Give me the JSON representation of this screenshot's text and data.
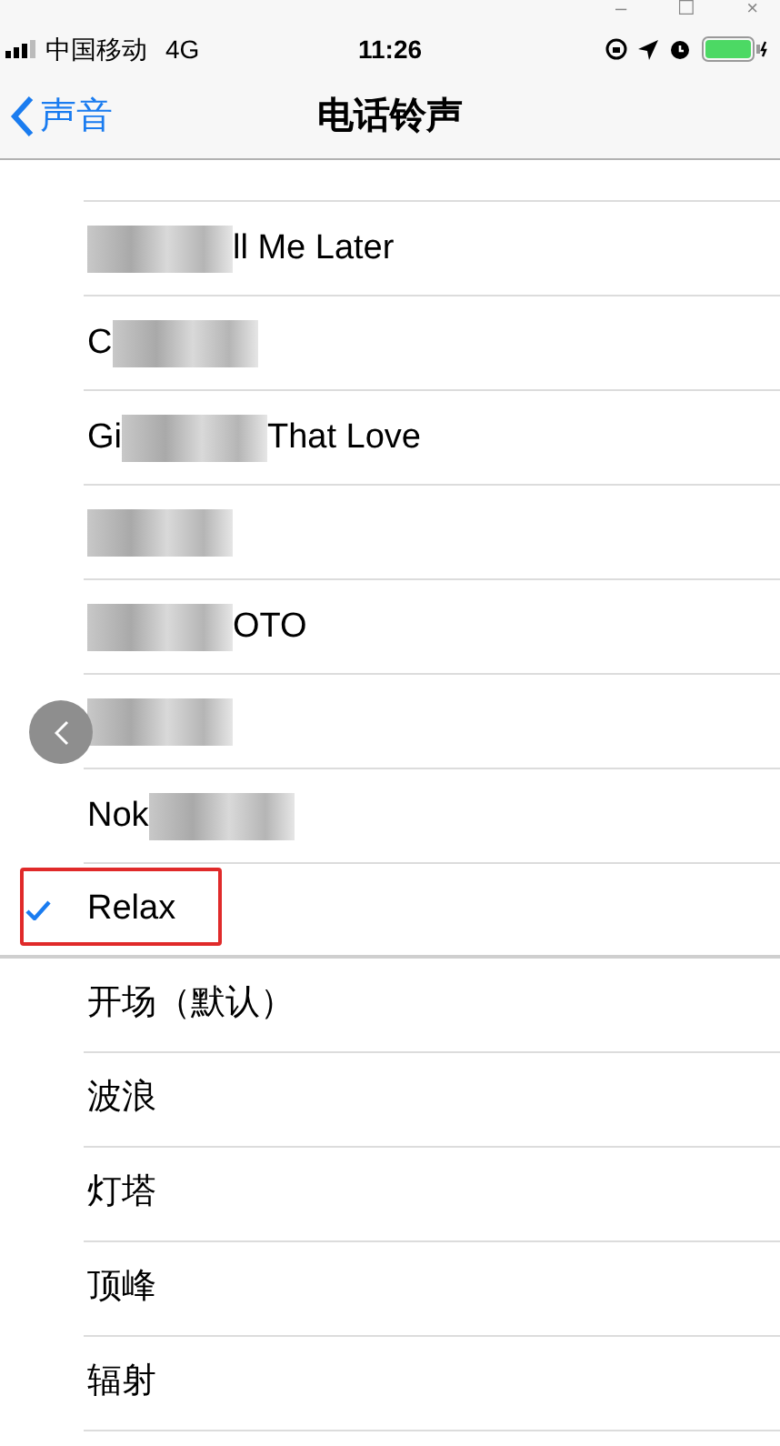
{
  "window_controls": [
    "–",
    "☐",
    "×"
  ],
  "status_bar": {
    "carrier": "中国移动",
    "network": "4G",
    "time": "11:26"
  },
  "nav": {
    "back": "声音",
    "title": "电话铃声"
  },
  "ringtones": [
    {
      "mosaic": true,
      "after": "ll Me Later",
      "selected": false
    },
    {
      "before": "C",
      "mosaic": true,
      "selected": false
    },
    {
      "before": "Gi",
      "mosaic": true,
      "after": "That Love",
      "selected": false
    },
    {
      "mosaic": true,
      "selected": false
    },
    {
      "mosaic": true,
      "after": "OTO",
      "selected": false
    },
    {
      "mosaic": true,
      "selected": false
    },
    {
      "before": "Nok",
      "mosaic": true,
      "selected": false
    },
    {
      "before": "Relax",
      "mosaic": false,
      "selected": true
    }
  ],
  "alert_tones": [
    "开场（默认）",
    "波浪",
    "灯塔",
    "顶峰",
    "辐射"
  ]
}
